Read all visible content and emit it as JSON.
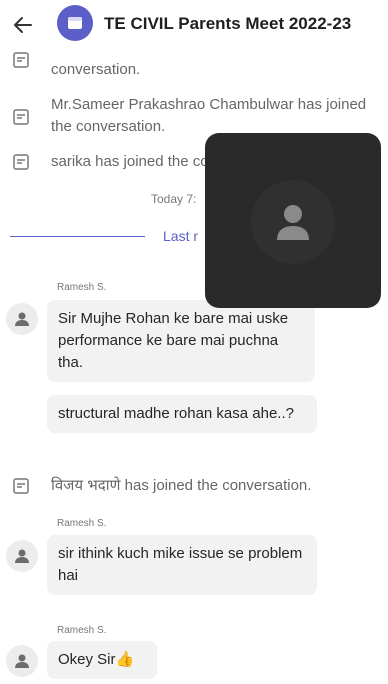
{
  "header": {
    "back_icon": "arrow-left-icon",
    "group_icon": "group-chat-icon",
    "title": "TE CIVIL Parents Meet 2022-23"
  },
  "events_top": [
    {
      "icon": "joined-conversation-icon",
      "text": "conversation."
    },
    {
      "icon": "joined-conversation-icon",
      "text": "Mr.Sameer Prakashrao Chambulwar has joined the conversation."
    },
    {
      "icon": "joined-conversation-icon",
      "text": "sarika has joined the conversation."
    }
  ],
  "date_label": "Today 7:",
  "last_read_label": "Last r",
  "messages_1": {
    "sender": "Ramesh S.",
    "bubbles": [
      "Sir Mujhe Rohan ke bare mai uske performance ke bare mai puchna tha.",
      "structural madhe rohan kasa ahe..?"
    ]
  },
  "event_mid": {
    "icon": "joined-conversation-icon",
    "text": "विजय भदाणे has joined the conversation."
  },
  "messages_2": {
    "sender": "Ramesh S.",
    "bubbles": [
      "sir ithink kuch mike issue se problem hai"
    ]
  },
  "messages_3": {
    "sender": "Ramesh S.",
    "bubbles": [
      "Okey Sir👍"
    ]
  },
  "video_tile": {
    "icon": "person-placeholder-icon"
  },
  "colors": {
    "accent": "#5b5fc7",
    "video_bg": "#2a2a2a",
    "bubble_bg": "#f2f2f2"
  }
}
